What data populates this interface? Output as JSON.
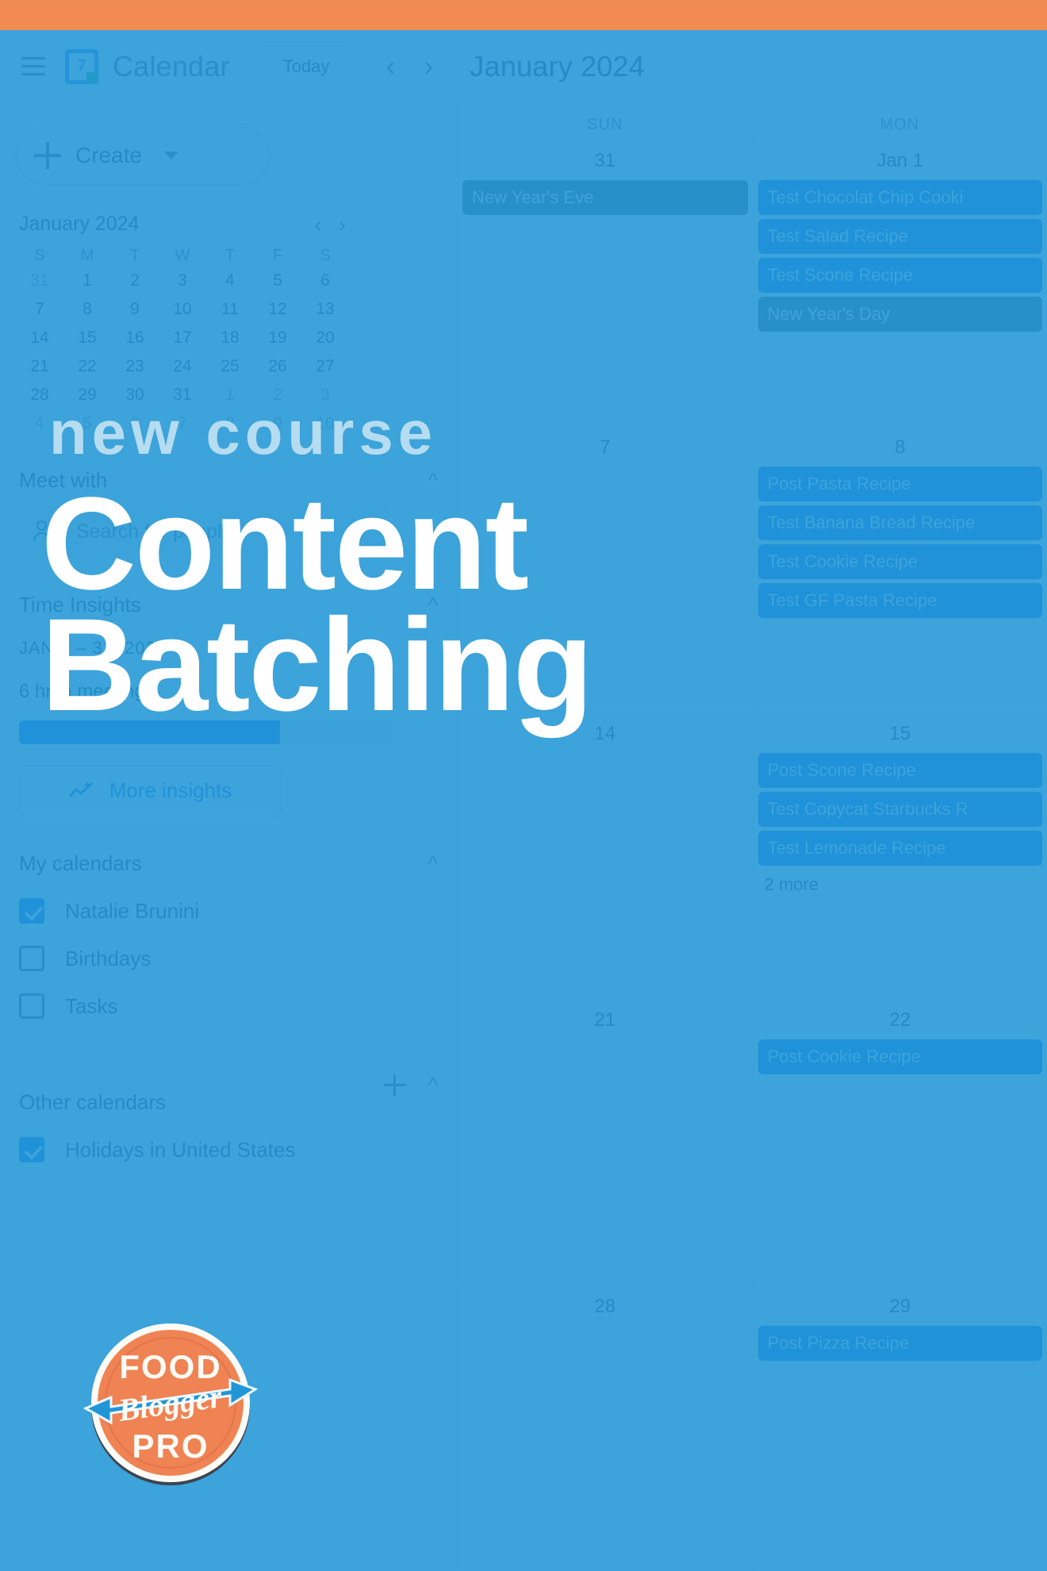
{
  "brand": {
    "accent_orange": "#f18b52",
    "overlay_blue": "#2196d6",
    "kicker_color": "#b5dcf0",
    "title_color": "#ffffff"
  },
  "overlay": {
    "kicker": "new course",
    "title_line1": "Content",
    "title_line2": "Batching"
  },
  "logo": {
    "top_word": "FOOD",
    "ribbon_word": "Blogger",
    "bottom_word": "PRO",
    "circle_color": "#ef8354",
    "ribbon_color": "#2196d6"
  },
  "header": {
    "menu_icon": "hamburger-icon",
    "logo_day": "7",
    "app_title": "Calendar",
    "today_label": "Today",
    "prev_icon": "chevron-left-icon",
    "next_icon": "chevron-right-icon",
    "month_title": "January 2024"
  },
  "sidebar": {
    "create_label": "Create",
    "create_caret": "chevron-down-icon",
    "mini_calendar": {
      "title": "January 2024",
      "prev_icon": "chevron-left-icon",
      "next_icon": "chevron-right-icon",
      "dow": [
        "S",
        "M",
        "T",
        "W",
        "T",
        "F",
        "S"
      ],
      "weeks": [
        [
          {
            "d": "31",
            "muted": true
          },
          {
            "d": "1"
          },
          {
            "d": "2"
          },
          {
            "d": "3"
          },
          {
            "d": "4"
          },
          {
            "d": "5"
          },
          {
            "d": "6"
          }
        ],
        [
          {
            "d": "7"
          },
          {
            "d": "8"
          },
          {
            "d": "9"
          },
          {
            "d": "10"
          },
          {
            "d": "11"
          },
          {
            "d": "12"
          },
          {
            "d": "13"
          }
        ],
        [
          {
            "d": "14"
          },
          {
            "d": "15"
          },
          {
            "d": "16"
          },
          {
            "d": "17"
          },
          {
            "d": "18"
          },
          {
            "d": "19"
          },
          {
            "d": "20"
          }
        ],
        [
          {
            "d": "21"
          },
          {
            "d": "22"
          },
          {
            "d": "23"
          },
          {
            "d": "24"
          },
          {
            "d": "25"
          },
          {
            "d": "26"
          },
          {
            "d": "27"
          }
        ],
        [
          {
            "d": "28"
          },
          {
            "d": "29"
          },
          {
            "d": "30"
          },
          {
            "d": "31"
          },
          {
            "d": "1",
            "muted": true
          },
          {
            "d": "2",
            "muted": true
          },
          {
            "d": "3",
            "muted": true
          }
        ],
        [
          {
            "d": "4",
            "muted": true
          },
          {
            "d": "5",
            "muted": true
          },
          {
            "d": "6",
            "muted": true
          },
          {
            "d": "7",
            "muted": true
          },
          {
            "d": "8",
            "muted": true
          },
          {
            "d": "9",
            "muted": true
          },
          {
            "d": "10",
            "muted": true
          }
        ]
      ]
    },
    "meet_with": {
      "title": "Meet with",
      "collapse_icon": "chevron-up-icon",
      "search_placeholder": "Search for people",
      "people_icon": "people-icon"
    },
    "time_insights": {
      "title": "Time Insights",
      "collapse_icon": "chevron-up-icon",
      "date_range": "JAN 1 – 31, 2024",
      "meetings_text": "6 hr in meetings",
      "progress_percent": 70,
      "more_label": "More insights",
      "more_icon": "insights-chart-icon"
    },
    "my_calendars": {
      "title": "My calendars",
      "collapse_icon": "chevron-up-icon",
      "items": [
        {
          "label": "Natalie Brunini",
          "checked": true
        },
        {
          "label": "Birthdays",
          "checked": false
        },
        {
          "label": "Tasks",
          "checked": false
        }
      ]
    },
    "other_calendars": {
      "title": "Other calendars",
      "add_icon": "plus-icon",
      "collapse_icon": "chevron-up-icon",
      "items": [
        {
          "label": "Holidays in United States",
          "checked": true
        }
      ]
    }
  },
  "grid": {
    "columns": [
      {
        "dow": "SUN"
      },
      {
        "dow": "MON"
      }
    ],
    "weeks": [
      {
        "days": [
          {
            "num": "31",
            "events": [
              {
                "title": "New Year's Eve",
                "style": "gray"
              }
            ],
            "more": null
          },
          {
            "num": "Jan 1",
            "events": [
              {
                "title": "Test Chocolat Chip Cooki",
                "style": "blue"
              },
              {
                "title": "Test Salad Recipe",
                "style": "blue"
              },
              {
                "title": "Test Scone Recipe",
                "style": "blue"
              },
              {
                "title": "New Year's Day",
                "style": "gray"
              }
            ],
            "more": null
          }
        ]
      },
      {
        "days": [
          {
            "num": "7",
            "events": [],
            "more": null
          },
          {
            "num": "8",
            "events": [
              {
                "title": "Post Pasta Recipe",
                "style": "blue"
              },
              {
                "title": "Test Banana Bread Recipe",
                "style": "blue"
              },
              {
                "title": "Test Cookie Recipe",
                "style": "blue"
              },
              {
                "title": "Test GF Pasta Recipe",
                "style": "blue"
              }
            ],
            "more": null
          }
        ]
      },
      {
        "days": [
          {
            "num": "14",
            "events": [],
            "more": null
          },
          {
            "num": "15",
            "events": [
              {
                "title": "Post Scone Recipe",
                "style": "blue"
              },
              {
                "title": "Test Copycat Starbucks R",
                "style": "blue"
              },
              {
                "title": "Test Lemonade Recipe",
                "style": "blue"
              }
            ],
            "more": "2 more"
          }
        ]
      },
      {
        "days": [
          {
            "num": "21",
            "events": [],
            "more": null
          },
          {
            "num": "22",
            "events": [
              {
                "title": "Post Cookie Recipe",
                "style": "blue"
              }
            ],
            "more": null
          }
        ]
      },
      {
        "days": [
          {
            "num": "28",
            "events": [],
            "more": null
          },
          {
            "num": "29",
            "events": [
              {
                "title": "Post Pizza Recipe",
                "style": "blue"
              }
            ],
            "more": null
          }
        ]
      }
    ]
  }
}
